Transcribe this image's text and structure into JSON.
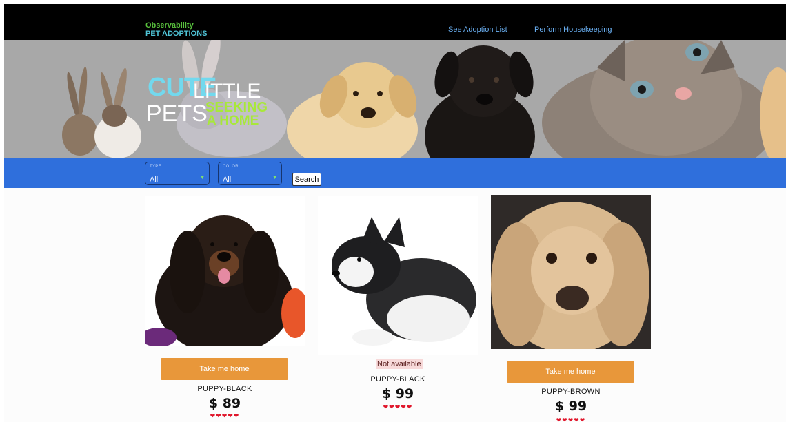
{
  "nav": {
    "brand_line1": "Observability",
    "brand_line2": "PET ADOPTIONS",
    "links": [
      "See Adoption List",
      "Perform Housekeeping"
    ]
  },
  "hero": {
    "word_cute": "CUTE",
    "word_little": "LITTLE",
    "word_pets": "PETS",
    "word_seeking": "SEEKING",
    "word_ahome": "A HOME"
  },
  "filters": {
    "type": {
      "label": "TYPE",
      "value": "All"
    },
    "color": {
      "label": "COLOR",
      "value": "All"
    },
    "search_label": "Search"
  },
  "pets": [
    {
      "name": "PUPPY-BLACK",
      "price": "$ 89",
      "action": "Take me home",
      "rating": 5,
      "available": true
    },
    {
      "name": "PUPPY-BLACK",
      "price": "$ 99",
      "status": "Not available",
      "rating": 5,
      "available": false
    },
    {
      "name": "PUPPY-BROWN",
      "price": "$ 99",
      "action": "Take me home",
      "rating": 5,
      "available": true
    }
  ],
  "colors": {
    "nav_bg": "#000000",
    "filter_bar": "#2f6fdc",
    "cta": "#e8973a",
    "heart": "#e0162b",
    "hero_bg": "#a8a8a8"
  },
  "icons": {
    "dropdown": "chevron-down-icon",
    "rating": "heart-icon"
  }
}
